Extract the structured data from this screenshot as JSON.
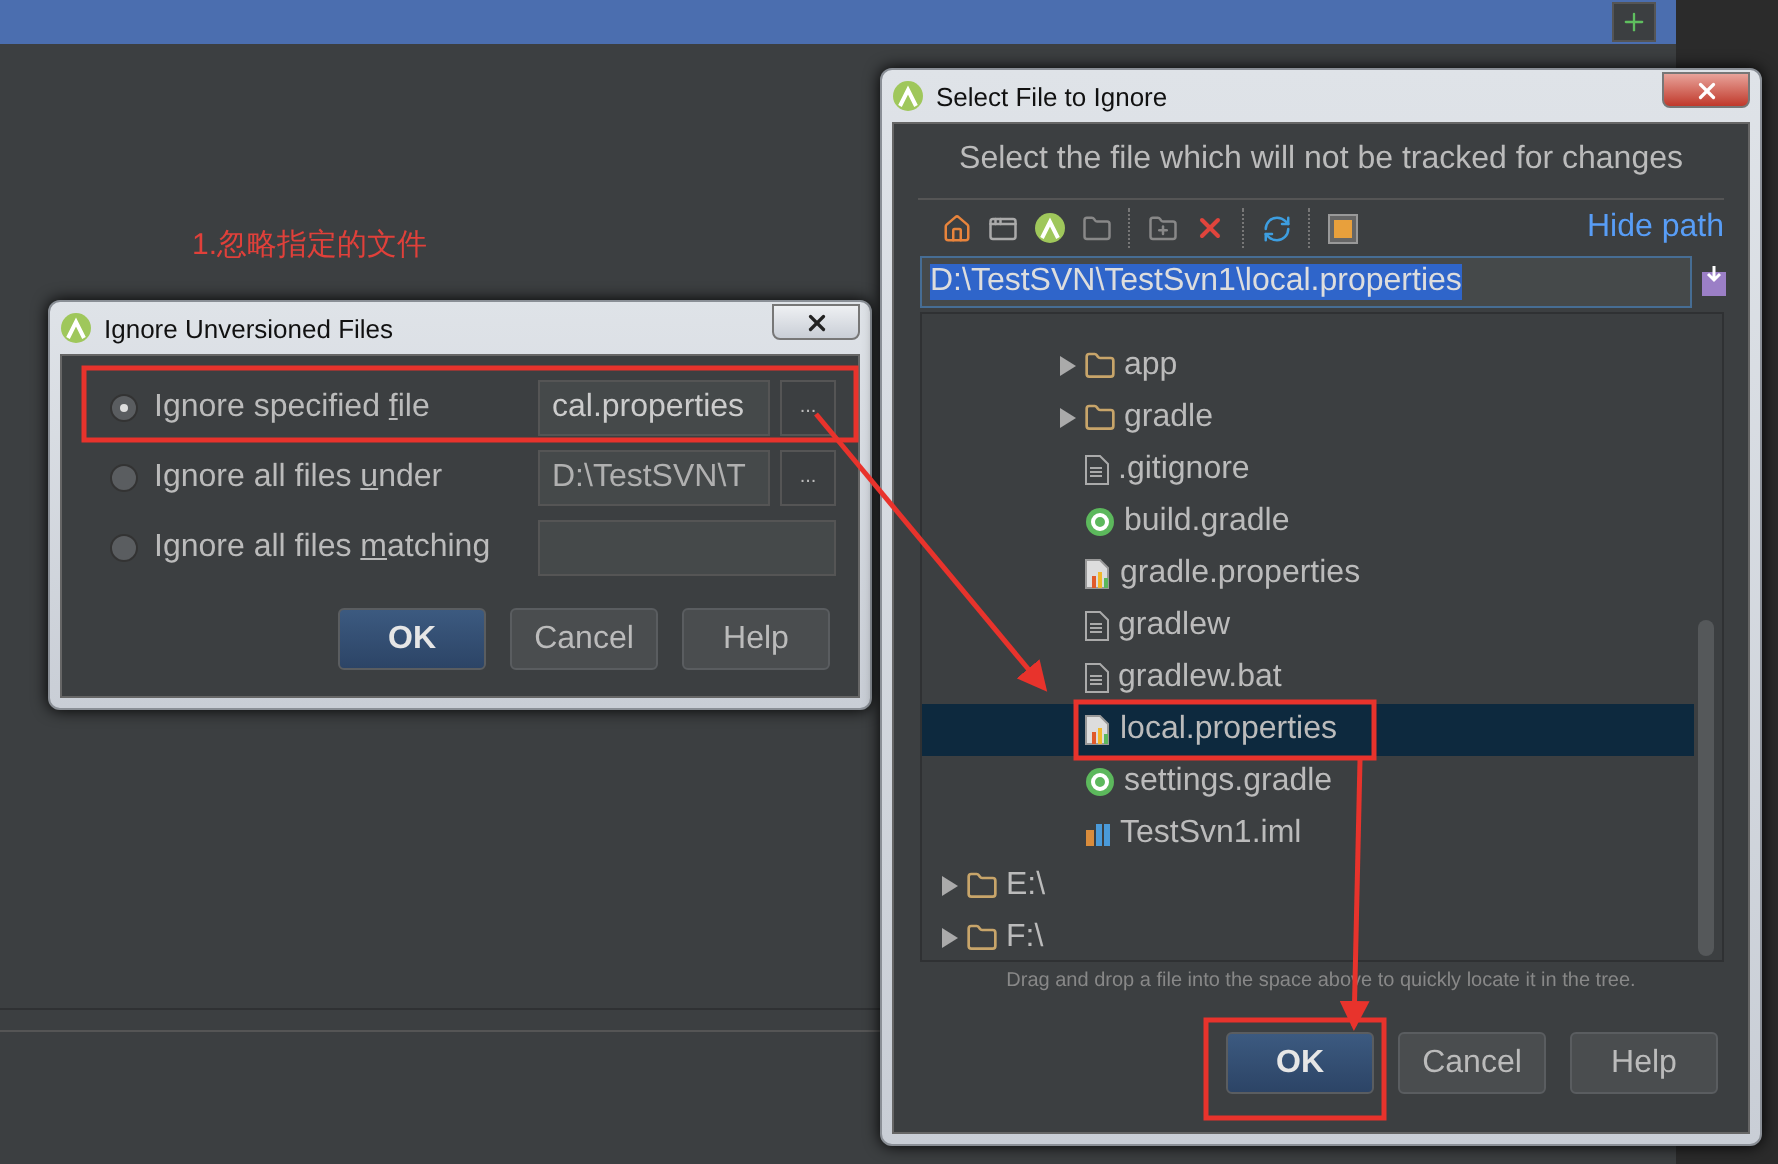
{
  "annotation": {
    "text": "1.忽略指定的文件"
  },
  "ignore_dialog": {
    "title": "Ignore Unversioned Files",
    "options": [
      {
        "before": "Ignore specified ",
        "mnemonic": "f",
        "after": "ile",
        "selected": true,
        "value": "cal.properties",
        "browse": "..."
      },
      {
        "before": "Ignore all files ",
        "mnemonic": "u",
        "after": "nder",
        "selected": false,
        "value": "D:\\TestSVN\\T",
        "browse": "..."
      },
      {
        "before": "Ignore all files ",
        "mnemonic": "m",
        "after": "atching",
        "selected": false
      }
    ],
    "buttons": [
      {
        "label": "OK",
        "default": true
      },
      {
        "label": "Cancel",
        "default": false
      },
      {
        "label": "Help",
        "default": false
      }
    ]
  },
  "file_dialog": {
    "title": "Select File to Ignore",
    "description": "Select the file which will not be tracked for changes",
    "hide_path": "Hide path",
    "path": {
      "value": "D:\\TestSVN\\TestSvn1\\local.properties",
      "text_selected": true
    },
    "tree": [
      {
        "children": [
          {
            "children": [
              {
                "label": "app",
                "kind": "folder",
                "expanded": false,
                "selected": false
              },
              {
                "label": "gradle",
                "kind": "folder",
                "expanded": false,
                "selected": false
              },
              {
                "label": ".gitignore",
                "kind": "file",
                "selected": false
              },
              {
                "label": "build.gradle",
                "kind": "gradle",
                "selected": false
              },
              {
                "label": "gradle.properties",
                "kind": "properties",
                "selected": false
              },
              {
                "label": "gradlew",
                "kind": "file",
                "selected": false
              },
              {
                "label": "gradlew.bat",
                "kind": "file",
                "selected": false
              },
              {
                "label": "local.properties",
                "kind": "properties",
                "selected": true
              },
              {
                "label": "settings.gradle",
                "kind": "gradle",
                "selected": false
              },
              {
                "label": "TestSvn1.iml",
                "kind": "module",
                "selected": false
              }
            ]
          }
        ]
      },
      {
        "label": "E:\\",
        "kind": "folder",
        "expanded": false,
        "selected": false
      },
      {
        "label": "F:\\",
        "kind": "folder",
        "expanded": false,
        "selected": false
      }
    ],
    "hint": "Drag and drop a file into the space above to quickly locate it in the tree.",
    "buttons": [
      {
        "label": "OK",
        "default": true
      },
      {
        "label": "Cancel",
        "default": false
      },
      {
        "label": "Help",
        "default": false
      }
    ]
  }
}
